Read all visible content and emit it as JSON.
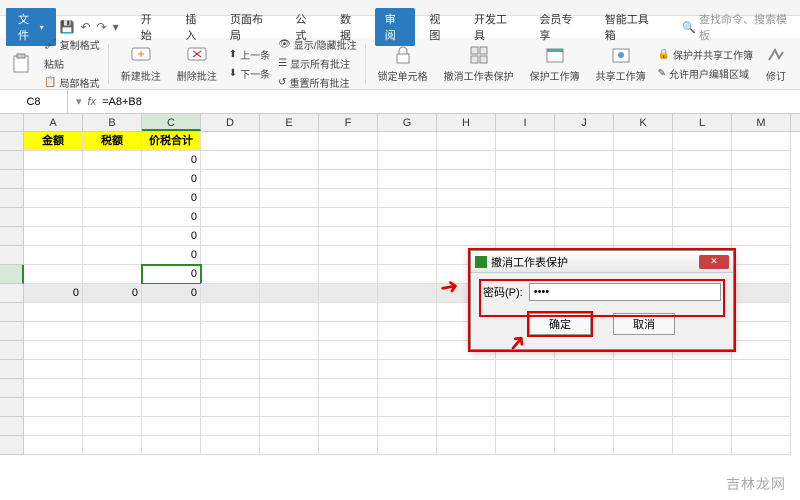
{
  "app": {
    "file_label": "文件",
    "search_hint": "查找命令、搜索模板"
  },
  "tabs": [
    "开始",
    "插入",
    "页面布局",
    "公式",
    "数据",
    "审阅",
    "视图",
    "开发工具",
    "会员专享",
    "智能工具箱"
  ],
  "active_tab_index": 5,
  "ribbon": {
    "section1": {
      "lbl1": "复制格式",
      "lbl2": "粘贴",
      "lbl3": "局部格式"
    },
    "section2": {
      "big1": "新建批注",
      "big2": "删除批注",
      "prev": "上一条",
      "next": "下一条",
      "showhide": "显示/隐藏批注",
      "showall": "显示所有批注",
      "resetall": "重置所有批注"
    },
    "section3": {
      "lock": "锁定单元格",
      "unprotect": "撤消工作表保护",
      "protectwb": "保护工作簿",
      "sharewb": "共享工作簿",
      "protshare": "保护并共享工作簿",
      "allowedit": "允许用户编辑区域",
      "track": "修订"
    }
  },
  "formula_bar": {
    "cell_ref": "C8",
    "formula": "=A8+B8"
  },
  "columns": [
    "A",
    "B",
    "C",
    "D",
    "E",
    "F",
    "G",
    "H",
    "I",
    "J",
    "K",
    "L",
    "M"
  ],
  "headers": {
    "A": "金额",
    "B": "税额",
    "C": "价税合计"
  },
  "col_c_values": [
    "0",
    "0",
    "0",
    "0",
    "0",
    "0",
    "0"
  ],
  "totals_row": {
    "A": "0",
    "B": "0",
    "C": "0"
  },
  "row_count": 17,
  "selected_cell": "C8",
  "dialog": {
    "title": "撤消工作表保护",
    "pw_label": "密码(P):",
    "pw_value": "••••",
    "ok": "确定",
    "cancel": "取消",
    "icon_color": "#2a8a2a"
  },
  "watermark": "吉林龙网"
}
